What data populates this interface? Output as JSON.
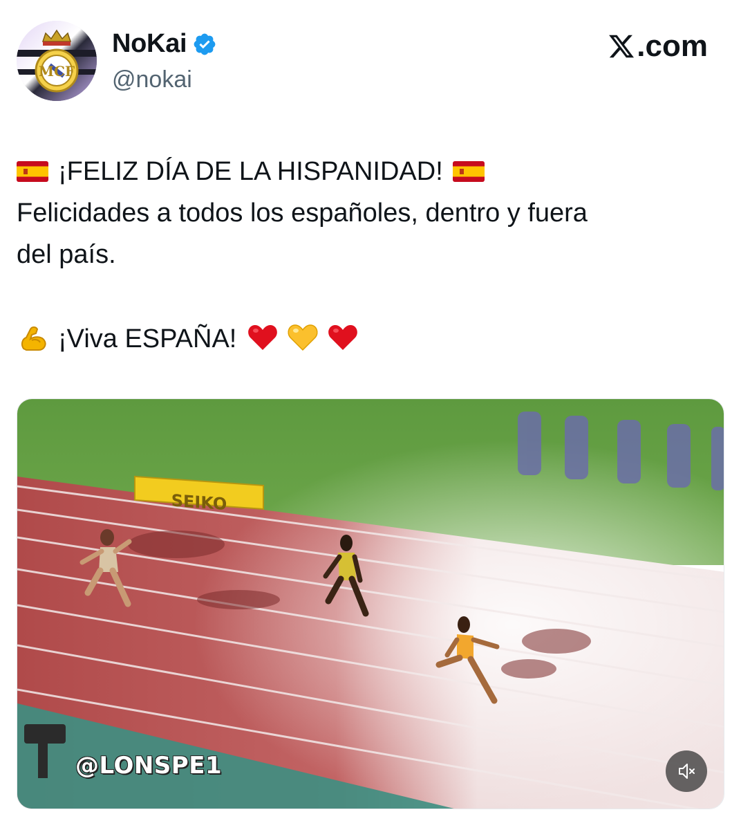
{
  "author": {
    "display_name": "NoKai",
    "handle": "@nokai",
    "verified": true,
    "avatar_icon": "real-madrid-crest"
  },
  "brand": {
    "label": ".com",
    "icon": "x-logo-icon"
  },
  "tweet": {
    "line1": "¡FELIZ DÍA DE LA HISPANIDAD!",
    "line2": "Felicidades a todos los españoles, dentro y fuera",
    "line3": "del país.",
    "line4": "¡Viva ESPAÑA!",
    "emojis": [
      "spain-flag",
      "spain-flag",
      "flexed-biceps",
      "red-heart",
      "yellow-heart",
      "red-heart"
    ]
  },
  "media": {
    "type": "video",
    "watermark": "@LONSPE1",
    "sponsor_board": "SEIKO",
    "mute_icon": "speaker-muted-icon"
  },
  "colors": {
    "verified_blue": "#1d9bf0",
    "handle_gray": "#536471",
    "text": "#0f1419"
  }
}
